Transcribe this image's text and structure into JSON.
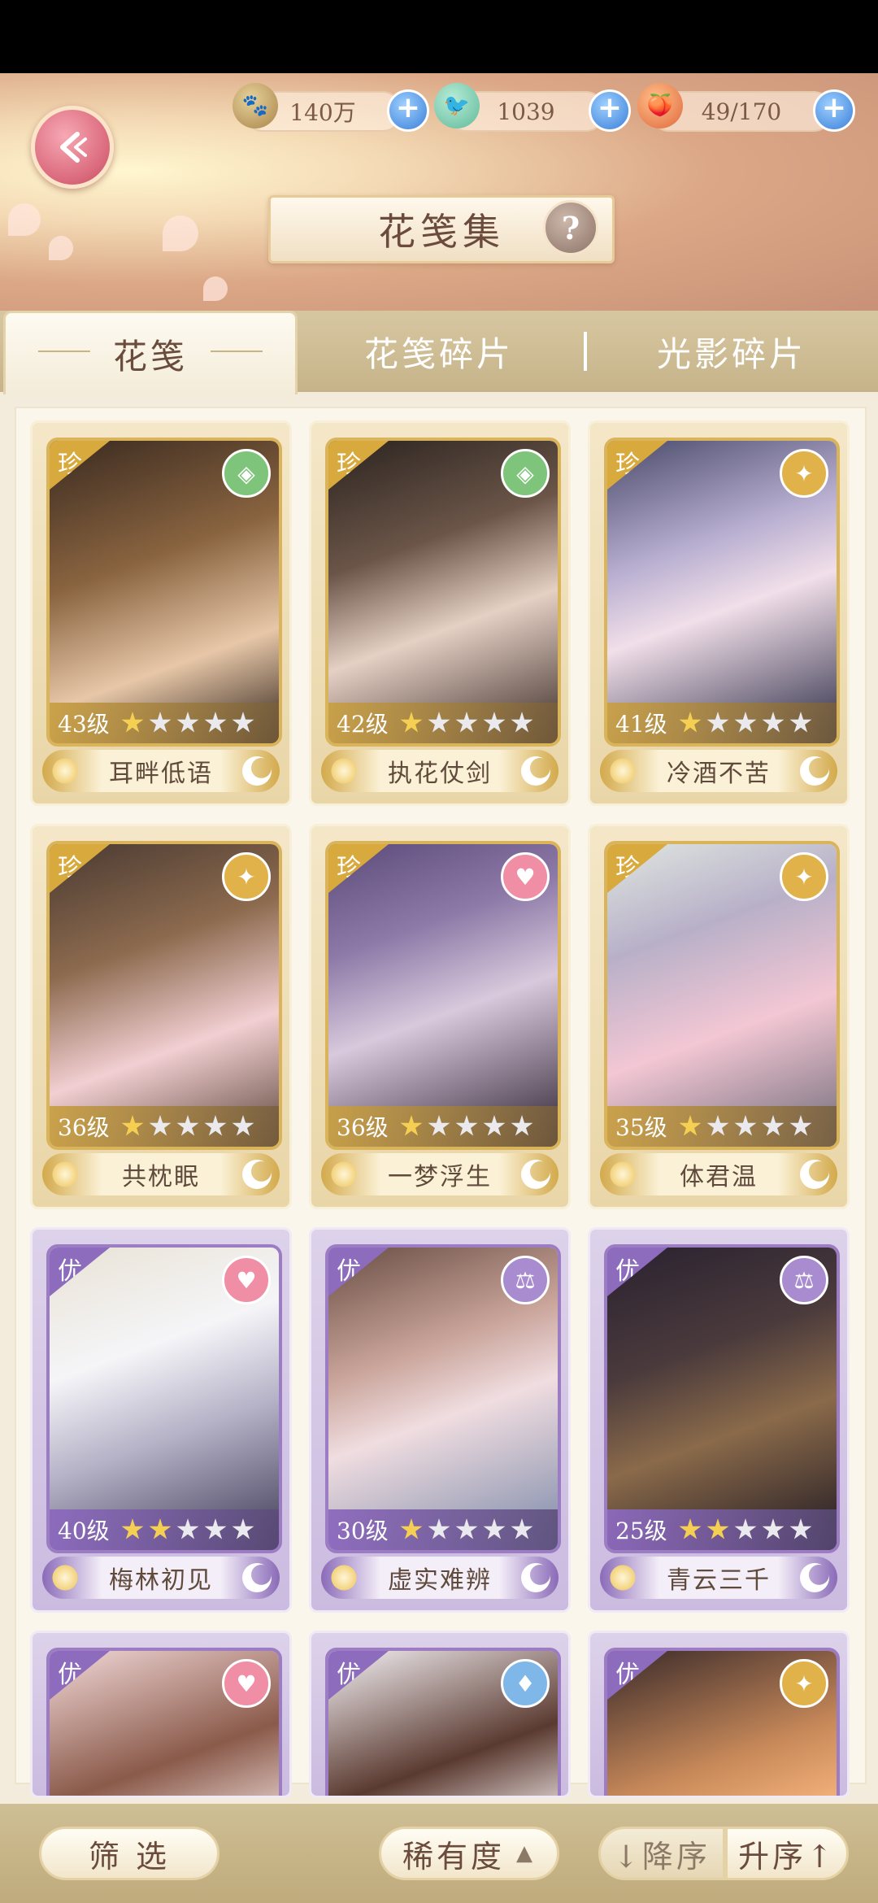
{
  "header": {
    "title": "花笺集",
    "back_label": "back",
    "resources": [
      {
        "icon": "paw-coin-icon",
        "value": "140万"
      },
      {
        "icon": "bird-token-icon",
        "value": "1039"
      },
      {
        "icon": "peach-stamina-icon",
        "value": "49/170"
      }
    ]
  },
  "tabs": [
    {
      "label": "花笺",
      "active": true
    },
    {
      "label": "花笺碎片",
      "active": false
    },
    {
      "label": "光影碎片",
      "active": false
    }
  ],
  "cards": [
    {
      "grade": "珍",
      "level": "43级",
      "stars": 1,
      "name": "耳畔低语",
      "badge": "green-lattice-icon"
    },
    {
      "grade": "珍",
      "level": "42级",
      "stars": 1,
      "name": "执花仗剑",
      "badge": "green-lattice-icon"
    },
    {
      "grade": "珍",
      "level": "41级",
      "stars": 1,
      "name": "冷酒不苦",
      "badge": "gold-wings-icon"
    },
    {
      "grade": "珍",
      "level": "36级",
      "stars": 1,
      "name": "共枕眠",
      "badge": "gold-wings-icon"
    },
    {
      "grade": "珍",
      "level": "36级",
      "stars": 1,
      "name": "一梦浮生",
      "badge": "pink-heart-icon"
    },
    {
      "grade": "珍",
      "level": "35级",
      "stars": 1,
      "name": "体君温",
      "badge": "gold-wings-icon"
    },
    {
      "grade": "优",
      "level": "40级",
      "stars": 2,
      "name": "梅林初见",
      "badge": "pink-heart-icon"
    },
    {
      "grade": "优",
      "level": "30级",
      "stars": 1,
      "name": "虚实难辨",
      "badge": "purple-scales-icon"
    },
    {
      "grade": "优",
      "level": "25级",
      "stars": 2,
      "name": "青云三千",
      "badge": "purple-scales-icon"
    },
    {
      "grade": "优",
      "badge": "pink-heart-icon"
    },
    {
      "grade": "优",
      "badge": "blue-flame-icon"
    },
    {
      "grade": "优",
      "badge": "gold-wings-icon"
    }
  ],
  "bottom": {
    "filter_label": "筛 选",
    "sort_label": "稀有度",
    "desc_label": "↓降序",
    "asc_label": "升序↑"
  },
  "colors": {
    "gold_frame": "#d9b45b",
    "purple_frame": "#9c7dc4",
    "star_on": "#f4cf52"
  }
}
